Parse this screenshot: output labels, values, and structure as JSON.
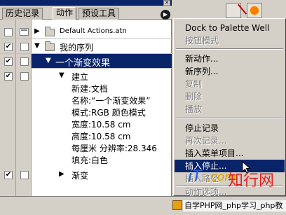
{
  "panel": {
    "tabs": [
      "历史记录",
      "动作",
      "预设工具"
    ],
    "active_tab": "动作"
  },
  "actions": {
    "default_set": "Default Actions.atn",
    "my_set": "我的序列",
    "action_name": "一个渐变效果",
    "step_name": "建立",
    "details": [
      "新建:文档",
      "名称:“一个渐变效果”",
      "模式:RGB 颜色模式",
      "宽度:10.58 cm",
      "高度:10.58 cm",
      "每厘米 分辨率:28.346",
      "填充:白色"
    ],
    "gradient_step": "渐变",
    "checkmark": "✔"
  },
  "menu": {
    "items": [
      {
        "label": "Dock to Palette Well",
        "disabled": false
      },
      {
        "label": "按钮模式",
        "disabled": true
      },
      {
        "label": "新动作...",
        "disabled": false
      },
      {
        "label": "新序列...",
        "disabled": false
      },
      {
        "label": "复制",
        "disabled": true
      },
      {
        "label": "删除",
        "disabled": true
      },
      {
        "label": "播放",
        "disabled": true
      },
      {
        "label": "停止记录",
        "disabled": false
      },
      {
        "label": "再次记录...",
        "disabled": true
      },
      {
        "label": "插入菜单项目...",
        "disabled": false
      },
      {
        "label": "插入停止...",
        "disabled": false,
        "highlighted": true
      },
      {
        "label": "插入路径",
        "disabled": true
      },
      {
        "label": "动作选项...",
        "disabled": true
      }
    ]
  },
  "watermark": {
    "it": "iT",
    "dom": ".com",
    "cn": "知行网",
    "footer_text": "自学PHP网_php学习_php教"
  },
  "colors": {
    "selection": "#0a246a",
    "panel_bg": "#d4d0c8",
    "disabled_text": "#808080"
  },
  "icons": [
    "close-icon",
    "panel-menu-icon",
    "dialog-toggle-icon",
    "folder-icon",
    "expand-triangle-icon",
    "collapse-triangle-icon",
    "check-icon",
    "mouse-cursor-icon"
  ]
}
